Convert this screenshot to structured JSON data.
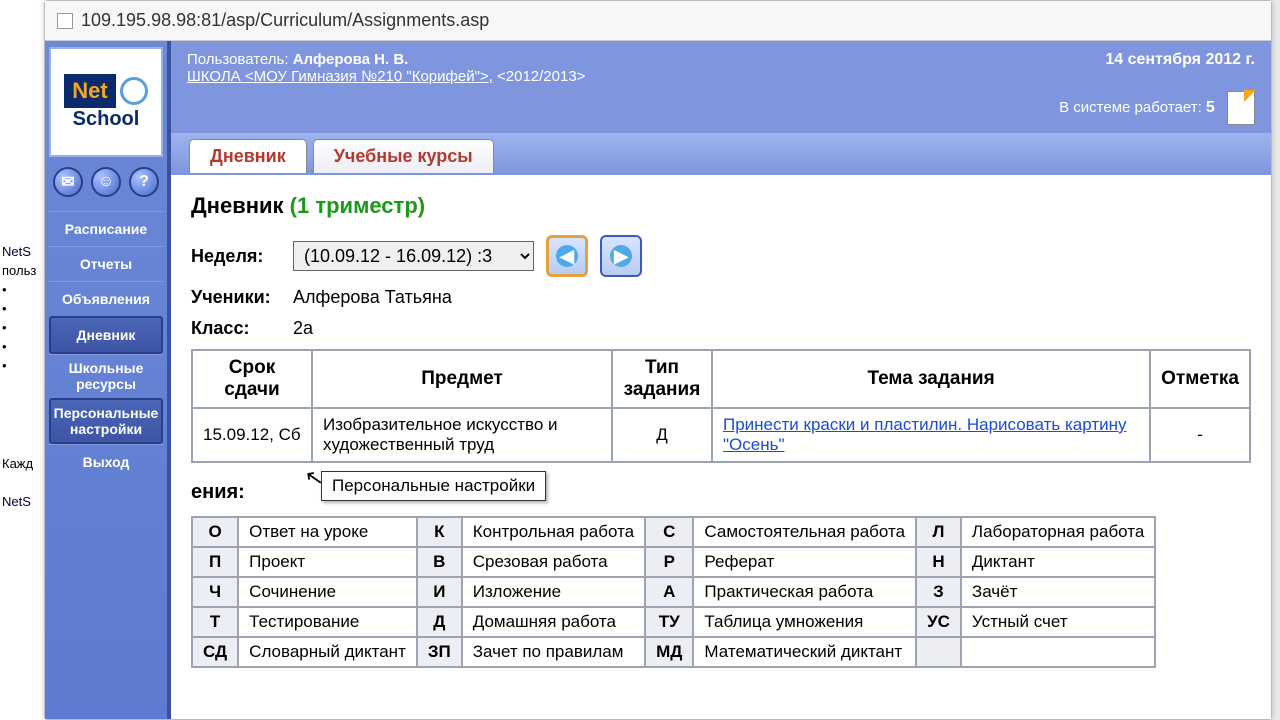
{
  "url": "109.195.98.98:81/asp/Curriculum/Assignments.asp",
  "bg": {
    "net": "NetS",
    "user": "польз",
    "every": "Кажд",
    "net2": "NetS"
  },
  "header": {
    "user_label": "Пользователь:",
    "user_name": "Алферова Н. В.",
    "school_link": "ШКОЛА <МОУ Гимназия №210 \"Корифей\">,",
    "year": "<2012/2013>",
    "date": "14 сентября 2012 г.",
    "online_label": "В системе работает:",
    "online_count": "5"
  },
  "logo": {
    "net": "Net",
    "school": "School"
  },
  "sidebar": {
    "items": [
      "Расписание",
      "Отчеты",
      "Объявления",
      "Дневник",
      "Школьные ресурсы",
      "Персональные настройки",
      "Выход"
    ]
  },
  "tabs": {
    "diary": "Дневник",
    "courses": "Учебные курсы"
  },
  "page": {
    "title": "Дневник",
    "trimester": "(1 триместр)",
    "week_label": "Неделя:",
    "week_value": "(10.09.12 - 16.09.12) :3",
    "students_label": "Ученики:",
    "students_value": "Алферова Татьяна",
    "class_label": "Класс:",
    "class_value": "2а"
  },
  "table": {
    "headers": [
      "Срок сдачи",
      "Предмет",
      "Тип задания",
      "Тема задания",
      "Отметка"
    ],
    "row": {
      "due": "15.09.12, Сб",
      "subject": "Изобразительное искусство и художественный труд",
      "type": "Д",
      "topic": "Принести краски и пластилин. Нарисовать картину \"Осень\"",
      "mark": "-"
    }
  },
  "tooltip": "Персональные настройки",
  "legend_partial_title": "ения:",
  "legend": [
    [
      {
        "c": "О",
        "t": "Ответ на уроке"
      },
      {
        "c": "К",
        "t": "Контрольная работа"
      },
      {
        "c": "С",
        "t": "Самостоятельная работа"
      },
      {
        "c": "Л",
        "t": "Лабораторная работа"
      }
    ],
    [
      {
        "c": "П",
        "t": "Проект"
      },
      {
        "c": "В",
        "t": "Срезовая работа"
      },
      {
        "c": "Р",
        "t": "Реферат"
      },
      {
        "c": "Н",
        "t": "Диктант"
      }
    ],
    [
      {
        "c": "Ч",
        "t": "Сочинение"
      },
      {
        "c": "И",
        "t": "Изложение"
      },
      {
        "c": "А",
        "t": "Практическая работа"
      },
      {
        "c": "З",
        "t": "Зачёт"
      }
    ],
    [
      {
        "c": "Т",
        "t": "Тестирование"
      },
      {
        "c": "Д",
        "t": "Домашняя работа"
      },
      {
        "c": "ТУ",
        "t": "Таблица умножения"
      },
      {
        "c": "УС",
        "t": "Устный счет"
      }
    ],
    [
      {
        "c": "СД",
        "t": "Словарный диктант"
      },
      {
        "c": "ЗП",
        "t": "Зачет по правилам"
      },
      {
        "c": "МД",
        "t": "Математический диктант"
      },
      {
        "c": "",
        "t": ""
      }
    ]
  ]
}
